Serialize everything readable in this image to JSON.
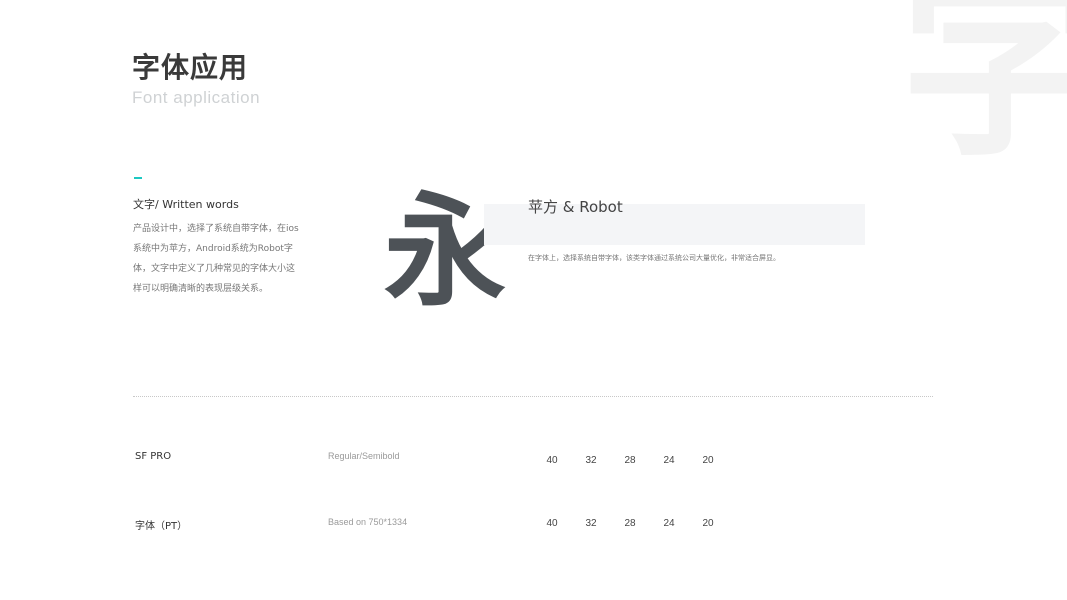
{
  "background_char": "字",
  "header": {
    "title": "字体应用",
    "subtitle": "Font application"
  },
  "section": {
    "heading": "文字/ Written words",
    "description": "产品设计中，选择了系统自带字体，在ios系统中为苹方，Android系统为Robot字体，文字中定义了几种常见的字体大小这样可以明确清晰的表现层级关系。"
  },
  "sample": {
    "glyph": "永",
    "font_name": "苹方 & Robot",
    "font_desc": "在字体上，选择系统自带字体，该类字体通过系统公司大量优化，非常适合屏显。"
  },
  "rows": [
    {
      "label": "SF PRO",
      "sub": "Regular/Semibold",
      "sizes": [
        "40",
        "32",
        "28",
        "24",
        "20"
      ]
    },
    {
      "label": "字体（PT）",
      "sub": "Based on 750*1334",
      "sizes": [
        "40",
        "32",
        "28",
        "24",
        "20"
      ]
    }
  ],
  "colors": {
    "accent": "#1cc8c2",
    "title": "#3a3a3a",
    "subtitle": "#cfd2d4",
    "glyph": "#4d5257",
    "band": "#f4f5f7"
  }
}
